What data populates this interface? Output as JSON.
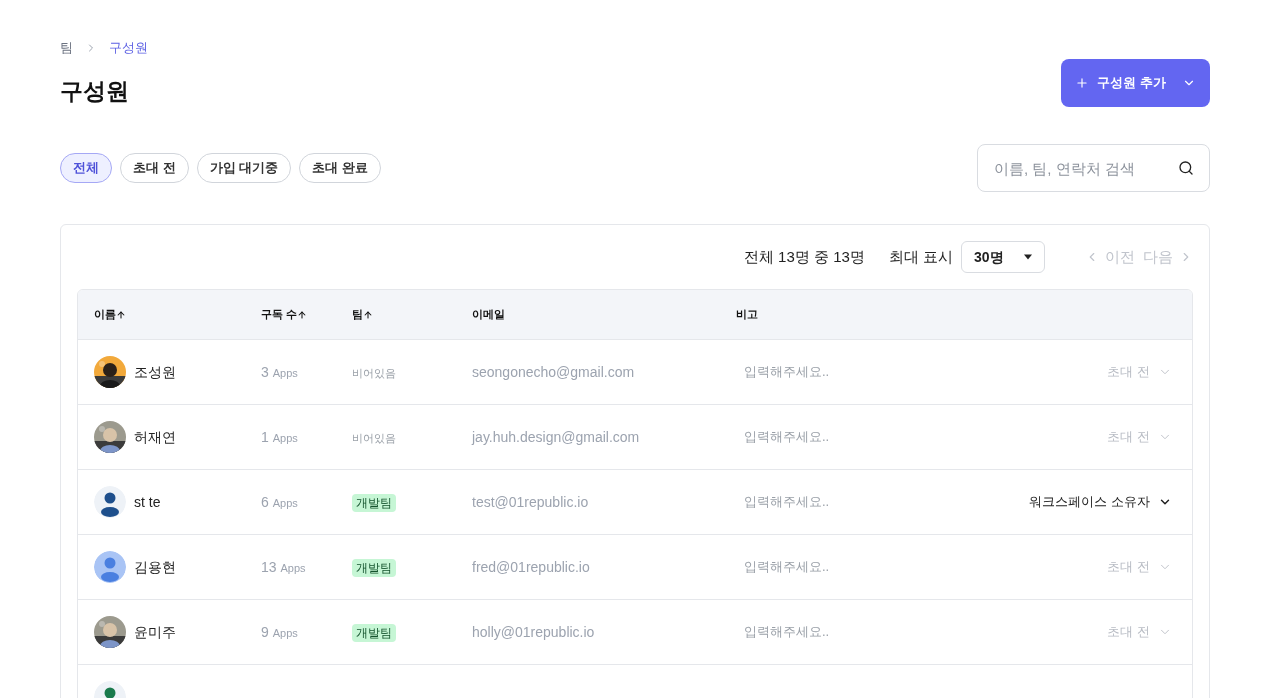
{
  "breadcrumb": [
    {
      "label": "팀",
      "current": false
    },
    {
      "label": "구성원",
      "current": true
    }
  ],
  "title": "구성원",
  "add_button": {
    "label": "구성원 추가"
  },
  "filters": [
    {
      "label": "전체",
      "selected": true
    },
    {
      "label": "초대 전",
      "selected": false
    },
    {
      "label": "가입 대기중",
      "selected": false
    },
    {
      "label": "초대 완료",
      "selected": false
    }
  ],
  "search": {
    "placeholder": "이름, 팀, 연락처 검색"
  },
  "summary": "전체 13명 중 13명",
  "page_size": {
    "label": "최대 표시",
    "value": "30명"
  },
  "pagination": {
    "prev": {
      "label": "이전",
      "disabled": true
    },
    "next": {
      "label": "다음",
      "disabled": true
    }
  },
  "table": {
    "columns": [
      {
        "label": "이름",
        "sorted": true
      },
      {
        "label": "구독 수",
        "sorted": true
      },
      {
        "label": "팀",
        "sorted": true
      },
      {
        "label": "이메일",
        "sorted": false
      },
      {
        "label": "비고",
        "sorted": false
      }
    ],
    "rows": [
      {
        "name": "조성원",
        "count": "3",
        "unit": "Apps",
        "team": {
          "kind": "empty",
          "label": "비어있음"
        },
        "email": "seongonecho@gmail.com",
        "note": {
          "placeholder": "입력해주세요.."
        },
        "role": {
          "label": "초대 전",
          "muted": true
        }
      },
      {
        "name": "허재연",
        "count": "1",
        "unit": "Apps",
        "team": {
          "kind": "empty",
          "label": "비어있음"
        },
        "email": "jay.huh.design@gmail.com",
        "note": {
          "placeholder": "입력해주세요.."
        },
        "role": {
          "label": "초대 전",
          "muted": true
        }
      },
      {
        "avatar": {
          "kind": "default",
          "color": "#1e4f8c"
        },
        "name": "st te",
        "count": "6",
        "unit": "Apps",
        "team": {
          "kind": "badge",
          "label": "개발팀"
        },
        "email": "test@01republic.io",
        "note": {
          "placeholder": "입력해주세요.."
        },
        "role": {
          "label": "워크스페이스 소유자",
          "muted": false
        }
      },
      {
        "avatar": {
          "kind": "default",
          "color": "#4a7fe0"
        },
        "name": "김용현",
        "count": "13",
        "unit": "Apps",
        "team": {
          "kind": "badge",
          "label": "개발팀"
        },
        "email": "fred@01republic.io",
        "note": {
          "placeholder": "입력해주세요.."
        },
        "role": {
          "label": "초대 전",
          "muted": true
        }
      },
      {
        "name": "윤미주",
        "count": "9",
        "unit": "Apps",
        "team": {
          "kind": "badge",
          "label": "개발팀"
        },
        "email": "holly@01republic.io",
        "note": {
          "placeholder": "입력해주세요.."
        },
        "role": {
          "label": "초대 전",
          "muted": true
        }
      },
      {
        "avatar": {
          "kind": "default",
          "color": "#1a7a4c"
        }
      }
    ]
  }
}
